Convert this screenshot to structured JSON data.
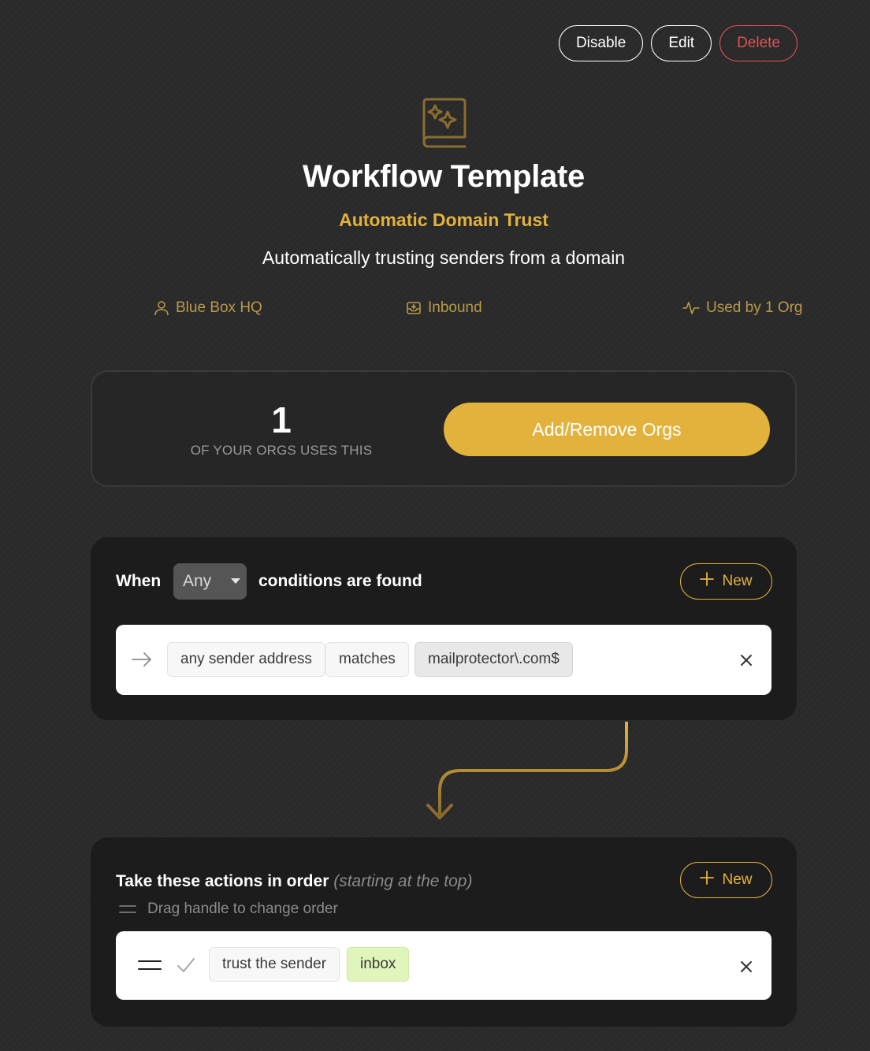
{
  "header_actions": {
    "disable_label": "Disable",
    "edit_label": "Edit",
    "delete_label": "Delete"
  },
  "template": {
    "icon": "sparkle-book-icon",
    "title": "Workflow Template",
    "name": "Automatic Domain Trust",
    "description": "Automatically trusting senders from a domain"
  },
  "meta": {
    "owner": "Blue Box HQ",
    "owner_icon": "user-icon",
    "direction": "Inbound",
    "direction_icon": "inbox-tray-icon",
    "usage": "Used by 1 Org",
    "usage_icon": "activity-icon"
  },
  "usage_card": {
    "count": "1",
    "label": "OF YOUR ORGS USES THIS",
    "button_label": "Add/Remove Orgs"
  },
  "conditions": {
    "prefix": "When",
    "match_mode": "Any",
    "suffix": "conditions are found",
    "new_label": "New",
    "rules": [
      {
        "icon": "arrow-right-icon",
        "field": "any sender address",
        "operator": "matches",
        "value": "mailprotector\\.com$"
      }
    ]
  },
  "actions": {
    "heading": "Take these actions in order",
    "heading_note": "(starting at the top)",
    "hint": "Drag handle to change order",
    "new_label": "New",
    "items": [
      {
        "icon": "check-icon",
        "action": "trust the sender",
        "target": "inbox"
      }
    ]
  },
  "colors": {
    "background": "#2b2b2b",
    "panel": "#1c1c1c",
    "accent": "#e3b23c",
    "danger": "#e05252",
    "meta": "#b89a4a"
  }
}
